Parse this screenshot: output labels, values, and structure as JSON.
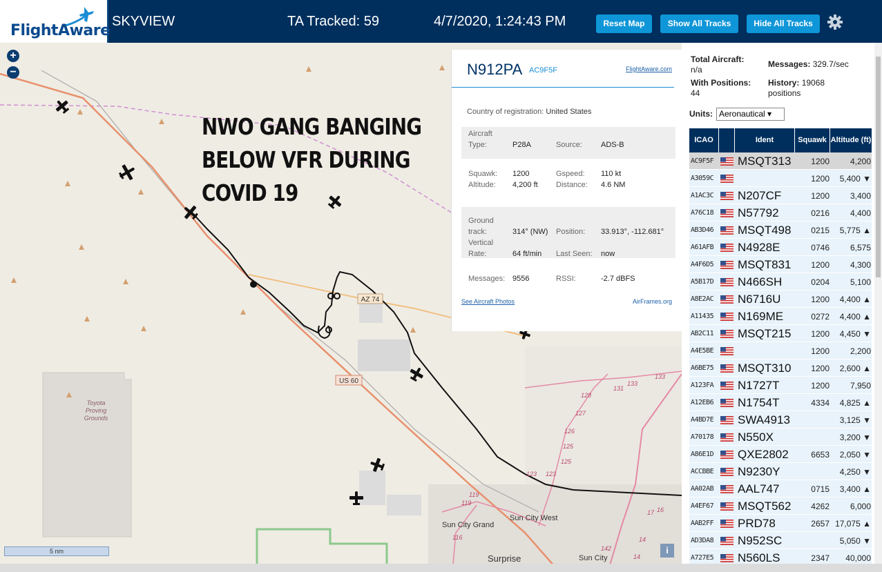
{
  "header": {
    "logo": "FlightAware",
    "title": "SKYVIEW",
    "tracked": "TA Tracked: 59",
    "datetime": "4/7/2020, 1:24:43 PM",
    "buttons": {
      "reset": "Reset Map",
      "show": "Show All Tracks",
      "hide": "Hide All Tracks"
    }
  },
  "map": {
    "overlay_text": [
      "NWO GANG BANGING",
      "BELOW VFR DURING",
      "COVID 19"
    ],
    "labels": {
      "az74": "AZ 74",
      "us60": "US 60",
      "toyota": [
        "Toyota",
        "Proving",
        "Grounds"
      ],
      "sun_city_grand": "Sun City Grand",
      "sun_city_west": "Sun City West",
      "surprise": "Surprise",
      "sun_city": "Sun City"
    },
    "route_numbers": [
      "119",
      "119",
      "116",
      "123",
      "123",
      "125",
      "125",
      "126",
      "127",
      "128",
      "131",
      "133",
      "133",
      "17",
      "16",
      "142",
      "14",
      "14"
    ],
    "scale": "5 nm",
    "zoom_in": "+",
    "zoom_out": "−",
    "info": "i"
  },
  "popup": {
    "registration": "N912PA",
    "icao": "AC9F5F",
    "link": "FlightAware.com",
    "country_label": "Country of registration:",
    "country": "United States",
    "aircraft_type_label": [
      "Aircraft",
      "Type:"
    ],
    "aircraft_type": "P28A",
    "source_label": "Source:",
    "source": "ADS-B",
    "squawk_label": "Squawk:",
    "squawk": "1200",
    "gspeed_label": "Gspeed:",
    "gspeed": "110 kt",
    "altitude_label": "Altitude:",
    "altitude": "4,200 ft",
    "distance_label": "Distance:",
    "distance": "4.6 NM",
    "track_label": [
      "Ground",
      "track:"
    ],
    "track": "314° (NW)",
    "position_label": "Position:",
    "position": "33.913°, -112.681°",
    "vrate_label": [
      "Vertical",
      "Rate:"
    ],
    "vrate": "64 ft/min",
    "lastseen_label": "Last Seen:",
    "lastseen": "now",
    "messages_label": "Messages:",
    "messages": "9556",
    "rssi_label": "RSSI:",
    "rssi": "-2.7 dBFS",
    "photos": "See Aircraft Photos",
    "airframes": "AirFrames.org"
  },
  "panel": {
    "total_label": "Total Aircraft:",
    "total": "n/a",
    "messages_label": "Messages:",
    "messages": "329.7/sec",
    "positions_label": "With Positions:",
    "positions": "44",
    "history_label": "History:",
    "history": "19068",
    "history_unit": "positions",
    "units_label": "Units:",
    "units_value": "Aeronautical ▾",
    "columns": [
      "ICAO",
      "",
      "Ident",
      "Squawk",
      "Altitude (ft)"
    ],
    "rows": [
      {
        "icao": "AC9F5F",
        "ident": "MSQT313",
        "squawk": "1200",
        "alt": "4,200"
      },
      {
        "icao": "A3059C",
        "ident": "",
        "squawk": "1200",
        "alt": "5,400 ▼"
      },
      {
        "icao": "A1AC3C",
        "ident": "N207CF",
        "squawk": "1200",
        "alt": "3,400"
      },
      {
        "icao": "A76C18",
        "ident": "N57792",
        "squawk": "0216",
        "alt": "4,400"
      },
      {
        "icao": "AB3D46",
        "ident": "MSQT498",
        "squawk": "0215",
        "alt": "5,775 ▲"
      },
      {
        "icao": "A61AFB",
        "ident": "N4928E",
        "squawk": "0746",
        "alt": "6,575"
      },
      {
        "icao": "A4F6D5",
        "ident": "MSQT831",
        "squawk": "1200",
        "alt": "4,300"
      },
      {
        "icao": "A5B17D",
        "ident": "N466SH",
        "squawk": "0204",
        "alt": "5,100"
      },
      {
        "icao": "A8E2AC",
        "ident": "N6716U",
        "squawk": "1200",
        "alt": "4,400 ▲"
      },
      {
        "icao": "A11435",
        "ident": "N169ME",
        "squawk": "0272",
        "alt": "4,400 ▲"
      },
      {
        "icao": "AB2C11",
        "ident": "MSQT215",
        "squawk": "1200",
        "alt": "4,450 ▼"
      },
      {
        "icao": "A4E5BE",
        "ident": "",
        "squawk": "1200",
        "alt": "2,200"
      },
      {
        "icao": "A6BE75",
        "ident": "MSQT310",
        "squawk": "1200",
        "alt": "2,600 ▲"
      },
      {
        "icao": "A123FA",
        "ident": "N1727T",
        "squawk": "1200",
        "alt": "7,950"
      },
      {
        "icao": "A12EB6",
        "ident": "N1754T",
        "squawk": "4334",
        "alt": "4,825 ▲"
      },
      {
        "icao": "A4BD7E",
        "ident": "SWA4913",
        "squawk": "",
        "alt": "3,125 ▼"
      },
      {
        "icao": "A70178",
        "ident": "N550X",
        "squawk": "",
        "alt": "3,200 ▼"
      },
      {
        "icao": "A86E1D",
        "ident": "QXE2802",
        "squawk": "6653",
        "alt": "2,050 ▼"
      },
      {
        "icao": "ACCBBE",
        "ident": "N9230Y",
        "squawk": "",
        "alt": "4,250 ▼"
      },
      {
        "icao": "AA02AB",
        "ident": "AAL747",
        "squawk": "0715",
        "alt": "3,400 ▲"
      },
      {
        "icao": "A4EF67",
        "ident": "MSQT562",
        "squawk": "4262",
        "alt": "6,000"
      },
      {
        "icao": "AAB2FF",
        "ident": "PRD78",
        "squawk": "2657",
        "alt": "17,075 ▲"
      },
      {
        "icao": "AD3DA8",
        "ident": "N952SC",
        "squawk": "",
        "alt": "5,050 ▼"
      },
      {
        "icao": "A727E5",
        "ident": "N560LS",
        "squawk": "2347",
        "alt": "40,000"
      }
    ]
  }
}
